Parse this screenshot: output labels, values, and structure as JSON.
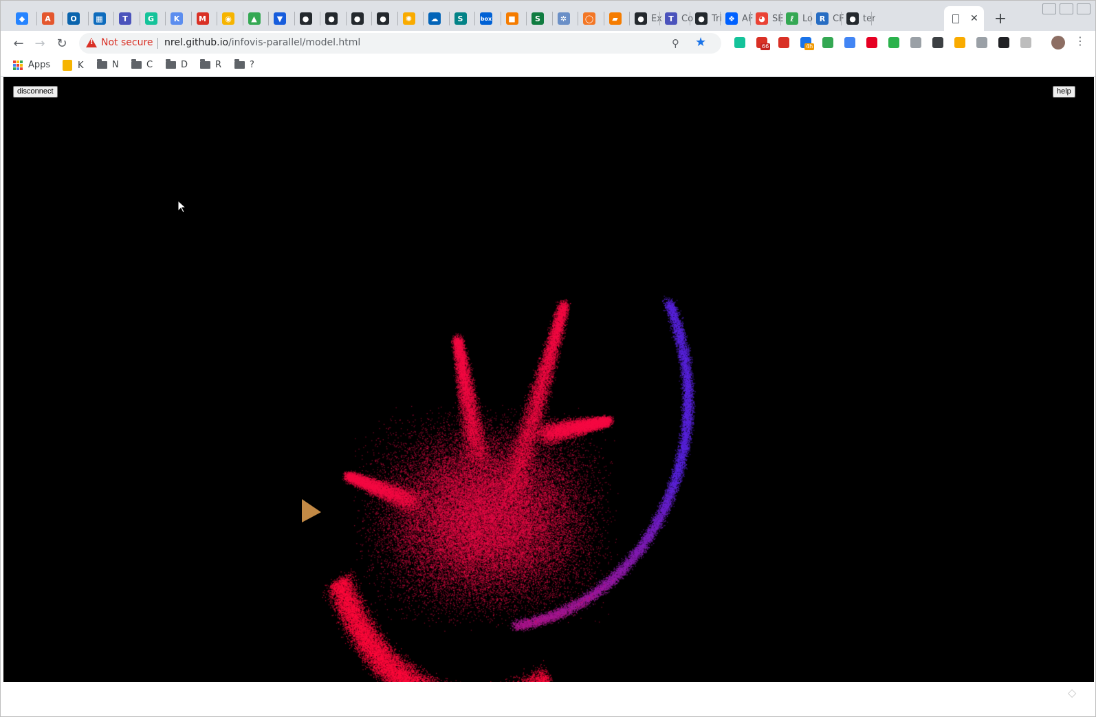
{
  "browser": {
    "tabs": [
      {
        "icon": "jira-icon",
        "color": "#2684ff",
        "glyph": "◆",
        "title": ""
      },
      {
        "icon": "acrobat-icon",
        "color": "#e4572e",
        "glyph": "A",
        "title": ""
      },
      {
        "icon": "outlook-icon",
        "color": "#0a64ad",
        "glyph": "O",
        "title": ""
      },
      {
        "icon": "sharepoint-icon",
        "color": "#0f6cbd",
        "glyph": "▦",
        "title": ""
      },
      {
        "icon": "teams-icon",
        "color": "#4b53bc",
        "glyph": "T",
        "title": ""
      },
      {
        "icon": "grammarly-icon",
        "color": "#15c39a",
        "glyph": "G",
        "title": ""
      },
      {
        "icon": "mapbox-icon",
        "color": "#5b8def",
        "glyph": "K",
        "title": ""
      },
      {
        "icon": "gmail-icon",
        "color": "#d93025",
        "glyph": "M",
        "title": ""
      },
      {
        "icon": "keep-icon",
        "color": "#f6b400",
        "glyph": "◉",
        "title": ""
      },
      {
        "icon": "drive-icon",
        "color": "#34a853",
        "glyph": "▲",
        "title": ""
      },
      {
        "icon": "bitwarden-icon",
        "color": "#175ddc",
        "glyph": "▼",
        "title": ""
      },
      {
        "icon": "github-icon",
        "color": "#24292e",
        "glyph": "●",
        "title": ""
      },
      {
        "icon": "github-icon",
        "color": "#24292e",
        "glyph": "●",
        "title": ""
      },
      {
        "icon": "github-icon",
        "color": "#24292e",
        "glyph": "●",
        "title": ""
      },
      {
        "icon": "github-icon",
        "color": "#24292e",
        "glyph": "●",
        "title": ""
      },
      {
        "icon": "weather-icon",
        "color": "#f9ab00",
        "glyph": "✺",
        "title": ""
      },
      {
        "icon": "onedrive-icon",
        "color": "#0364b8",
        "glyph": "☁",
        "title": ""
      },
      {
        "icon": "sharepoint-icon",
        "color": "#038387",
        "glyph": "S",
        "title": ""
      },
      {
        "icon": "box-icon",
        "color": "#0061d5",
        "glyph": "box",
        "title": ""
      },
      {
        "icon": "cube-icon",
        "color": "#f57c00",
        "glyph": "■",
        "title": ""
      },
      {
        "icon": "sway-icon",
        "color": "#107c41",
        "glyph": "S",
        "title": ""
      },
      {
        "icon": "gear-icon",
        "color": "#6a8fc7",
        "glyph": "✲",
        "title": ""
      },
      {
        "icon": "jupyter-icon",
        "color": "#f37726",
        "glyph": "◯",
        "title": ""
      },
      {
        "icon": "book-icon",
        "color": "#f57c00",
        "glyph": "▰",
        "title": ""
      },
      {
        "icon": "github-icon",
        "color": "#24292e",
        "glyph": "●",
        "title": "Ex"
      },
      {
        "icon": "teams-icon",
        "color": "#4b53bc",
        "glyph": "T",
        "title": "Co"
      },
      {
        "icon": "github-icon",
        "color": "#24292e",
        "glyph": "●",
        "title": "Tri"
      },
      {
        "icon": "dropbox-icon",
        "color": "#0061ff",
        "glyph": "❖",
        "title": "AF"
      },
      {
        "icon": "chrome-icon",
        "color": "#ea4335",
        "glyph": "◕",
        "title": "SE"
      },
      {
        "icon": "leaf-icon",
        "color": "#34a853",
        "glyph": "ℓ",
        "title": "Lo"
      },
      {
        "icon": "r-icon",
        "color": "#276dc3",
        "glyph": "R",
        "title": "CF"
      },
      {
        "icon": "github-icon",
        "color": "#24292e",
        "glyph": "●",
        "title": "ter"
      }
    ],
    "url_host": "nrel.github.io",
    "url_path": "/infovis-parallel/model.html",
    "security": "Not secure",
    "extensions": [
      {
        "icon": "grammarly-icon",
        "color": "#15c39a"
      },
      {
        "icon": "gmail-icon",
        "color": "#d93025",
        "badge": "66"
      },
      {
        "icon": "gmail-icon",
        "color": "#d93025"
      },
      {
        "icon": "calendar-icon",
        "color": "#1a73e8",
        "badge": "4h"
      },
      {
        "icon": "drive-icon",
        "color": "#34a853"
      },
      {
        "icon": "translate-icon",
        "color": "#4285f4"
      },
      {
        "icon": "pinterest-icon",
        "color": "#e60023"
      },
      {
        "icon": "feedly-icon",
        "color": "#2bb24c"
      },
      {
        "icon": "tag-icon",
        "color": "#9aa0a6"
      },
      {
        "icon": "lightbulb-icon",
        "color": "#3c4043"
      },
      {
        "icon": "star-badge-icon",
        "color": "#f9ab00"
      },
      {
        "icon": "document-icon",
        "color": "#9aa0a6"
      },
      {
        "icon": "eye-icon",
        "color": "#202124"
      },
      {
        "icon": "circle-icon",
        "color": "#bdbdbd"
      }
    ],
    "bookmarks": [
      {
        "icon": "apps-icon",
        "label": "Apps"
      },
      {
        "icon": "keep-icon",
        "label": "K"
      },
      {
        "icon": "folder-icon",
        "label": "N"
      },
      {
        "icon": "folder-icon",
        "label": "C"
      },
      {
        "icon": "folder-icon",
        "label": "D"
      },
      {
        "icon": "folder-icon",
        "label": "R"
      },
      {
        "icon": "folder-icon",
        "label": "?"
      }
    ]
  },
  "page": {
    "disconnect_label": "disconnect",
    "help_label": "help",
    "background": "#000000",
    "point_colors": [
      "#ff0a3c",
      "#5a24e0"
    ]
  }
}
